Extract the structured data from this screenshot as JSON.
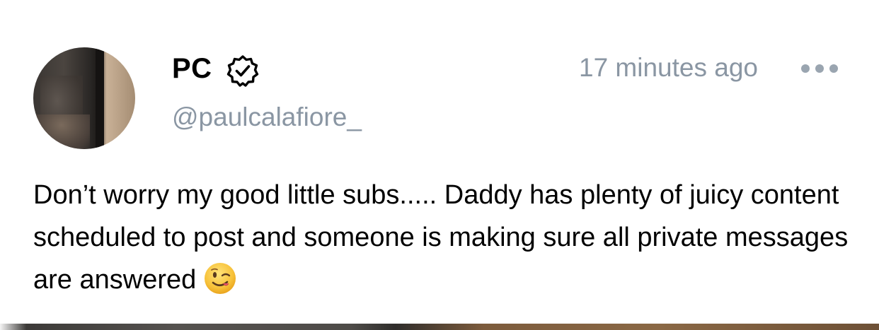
{
  "post": {
    "author_name": "PC",
    "author_handle": "@paulcalafiore_",
    "timestamp": "17 minutes ago",
    "body": "Don’t worry my good little subs..... Daddy has plenty of juicy content scheduled to post and someone is making sure all private messages are answered",
    "emoji": "winking-face",
    "verified_icon": "verified-badge-icon",
    "more_icon": "more-options-icon"
  },
  "colors": {
    "name": "#000000",
    "secondary_text": "#8a96a3",
    "more_dots": "#9aa5b0",
    "background": "#ffffff"
  }
}
